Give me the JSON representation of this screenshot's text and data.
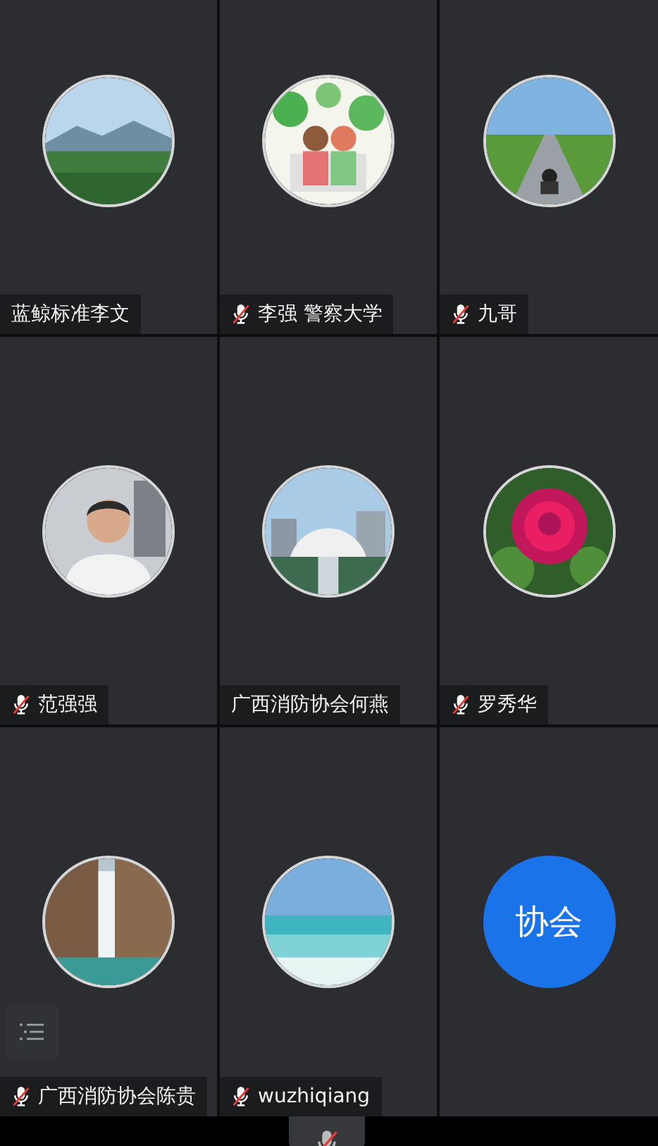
{
  "participants": [
    {
      "name": "蓝鲸标准李文",
      "muted": false
    },
    {
      "name": "李强 警察大学",
      "muted": true
    },
    {
      "name": "九哥",
      "muted": true
    },
    {
      "name": "范强强",
      "muted": true
    },
    {
      "name": "广西消防协会何燕",
      "muted": false
    },
    {
      "name": "罗秀华",
      "muted": true
    },
    {
      "name": "广西消防协会陈贵",
      "muted": true
    },
    {
      "name": "wuzhiqiang",
      "muted": true
    },
    {
      "avatar": {
        "kind": "text",
        "text": "协会"
      }
    }
  ],
  "mic_muted": true
}
